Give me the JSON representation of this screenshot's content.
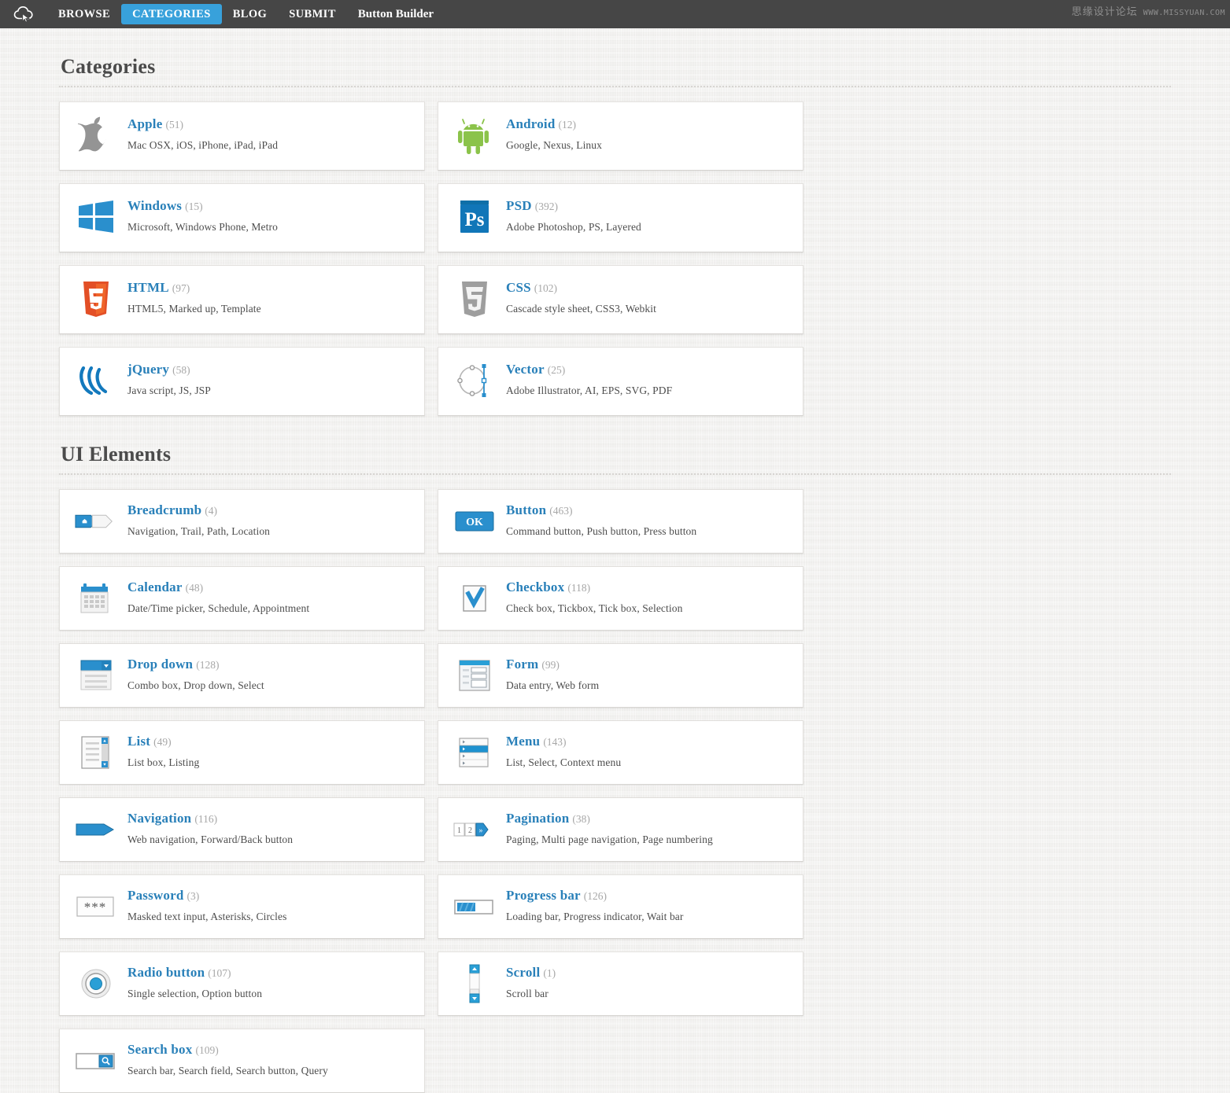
{
  "nav": {
    "logo_icon": "cloud-cursor-icon",
    "items": [
      {
        "label": "BROWSE",
        "active": false
      },
      {
        "label": "CATEGORIES",
        "active": true
      },
      {
        "label": "BLOG",
        "active": false
      },
      {
        "label": "SUBMIT",
        "active": false
      },
      {
        "label": "Button Builder",
        "active": false
      }
    ],
    "active_color": "#38a1db",
    "bar_color": "#464646"
  },
  "watermark": {
    "cn": "思缘设计论坛",
    "en": "WWW.MISSYUAN.COM"
  },
  "sections": [
    {
      "id": "categories",
      "title": "Categories",
      "cards": [
        {
          "icon": "apple-logo-icon",
          "title": "Apple",
          "count": "(51)",
          "desc": "Mac OSX, iOS, iPhone, iPad, iPad"
        },
        {
          "icon": "android-robot-icon",
          "title": "Android",
          "count": "(12)",
          "desc": "Google, Nexus, Linux"
        },
        {
          "icon": "windows-logo-icon",
          "title": "Windows",
          "count": "(15)",
          "desc": "Microsoft, Windows Phone, Metro"
        },
        {
          "icon": "photoshop-ps-icon",
          "title": "PSD",
          "count": "(392)",
          "desc": "Adobe Photoshop, PS, Layered"
        },
        {
          "icon": "html5-shield-icon",
          "title": "HTML",
          "count": "(97)",
          "desc": "HTML5, Marked up, Template"
        },
        {
          "icon": "css3-shield-icon",
          "title": "CSS",
          "count": "(102)",
          "desc": "Cascade style sheet, CSS3, Webkit"
        },
        {
          "icon": "jquery-logo-icon",
          "title": "jQuery",
          "count": "(58)",
          "desc": "Java script, JS, JSP"
        },
        {
          "icon": "vector-path-icon",
          "title": "Vector",
          "count": "(25)",
          "desc": "Adobe Illustrator, AI, EPS, SVG, PDF"
        }
      ]
    },
    {
      "id": "ui-elements",
      "title": "UI Elements",
      "cards": [
        {
          "icon": "breadcrumb-icon",
          "title": "Breadcrumb",
          "count": "(4)",
          "desc": "Navigation, Trail, Path, Location"
        },
        {
          "icon": "ok-button-icon",
          "title": "Button",
          "count": "(463)",
          "desc": "Command button, Push button, Press button"
        },
        {
          "icon": "calendar-icon",
          "title": "Calendar",
          "count": "(48)",
          "desc": "Date/Time picker, Schedule, Appointment"
        },
        {
          "icon": "checkbox-icon",
          "title": "Checkbox",
          "count": "(118)",
          "desc": "Check box, Tickbox, Tick box, Selection"
        },
        {
          "icon": "dropdown-icon",
          "title": "Drop down",
          "count": "(128)",
          "desc": "Combo box, Drop down, Select"
        },
        {
          "icon": "form-icon",
          "title": "Form",
          "count": "(99)",
          "desc": "Data entry, Web form"
        },
        {
          "icon": "list-icon",
          "title": "List",
          "count": "(49)",
          "desc": "List box, Listing"
        },
        {
          "icon": "menu-icon",
          "title": "Menu",
          "count": "(143)",
          "desc": "List, Select, Context menu"
        },
        {
          "icon": "navigation-arrow-icon",
          "title": "Navigation",
          "count": "(116)",
          "desc": "Web navigation, Forward/Back button"
        },
        {
          "icon": "pagination-icon",
          "title": "Pagination",
          "count": "(38)",
          "desc": "Paging, Multi page navigation, Page numbering"
        },
        {
          "icon": "password-icon",
          "title": "Password",
          "count": "(3)",
          "desc": "Masked text input, Asterisks, Circles"
        },
        {
          "icon": "progress-bar-icon",
          "title": "Progress bar",
          "count": "(126)",
          "desc": "Loading bar, Progress indicator, Wait bar"
        },
        {
          "icon": "radio-button-icon",
          "title": "Radio button",
          "count": "(107)",
          "desc": "Single selection, Option button"
        },
        {
          "icon": "scrollbar-icon",
          "title": "Scroll",
          "count": "(1)",
          "desc": "Scroll bar"
        },
        {
          "icon": "search-box-icon",
          "title": "Search box",
          "count": "(109)",
          "desc": "Search bar, Search field, Search button, Query"
        }
      ]
    }
  ],
  "colors": {
    "accent": "#38a1db",
    "link": "#2980b9",
    "count": "#a7a7a7",
    "nav_bg": "#464646",
    "page_bg": "#f2f1ef"
  }
}
